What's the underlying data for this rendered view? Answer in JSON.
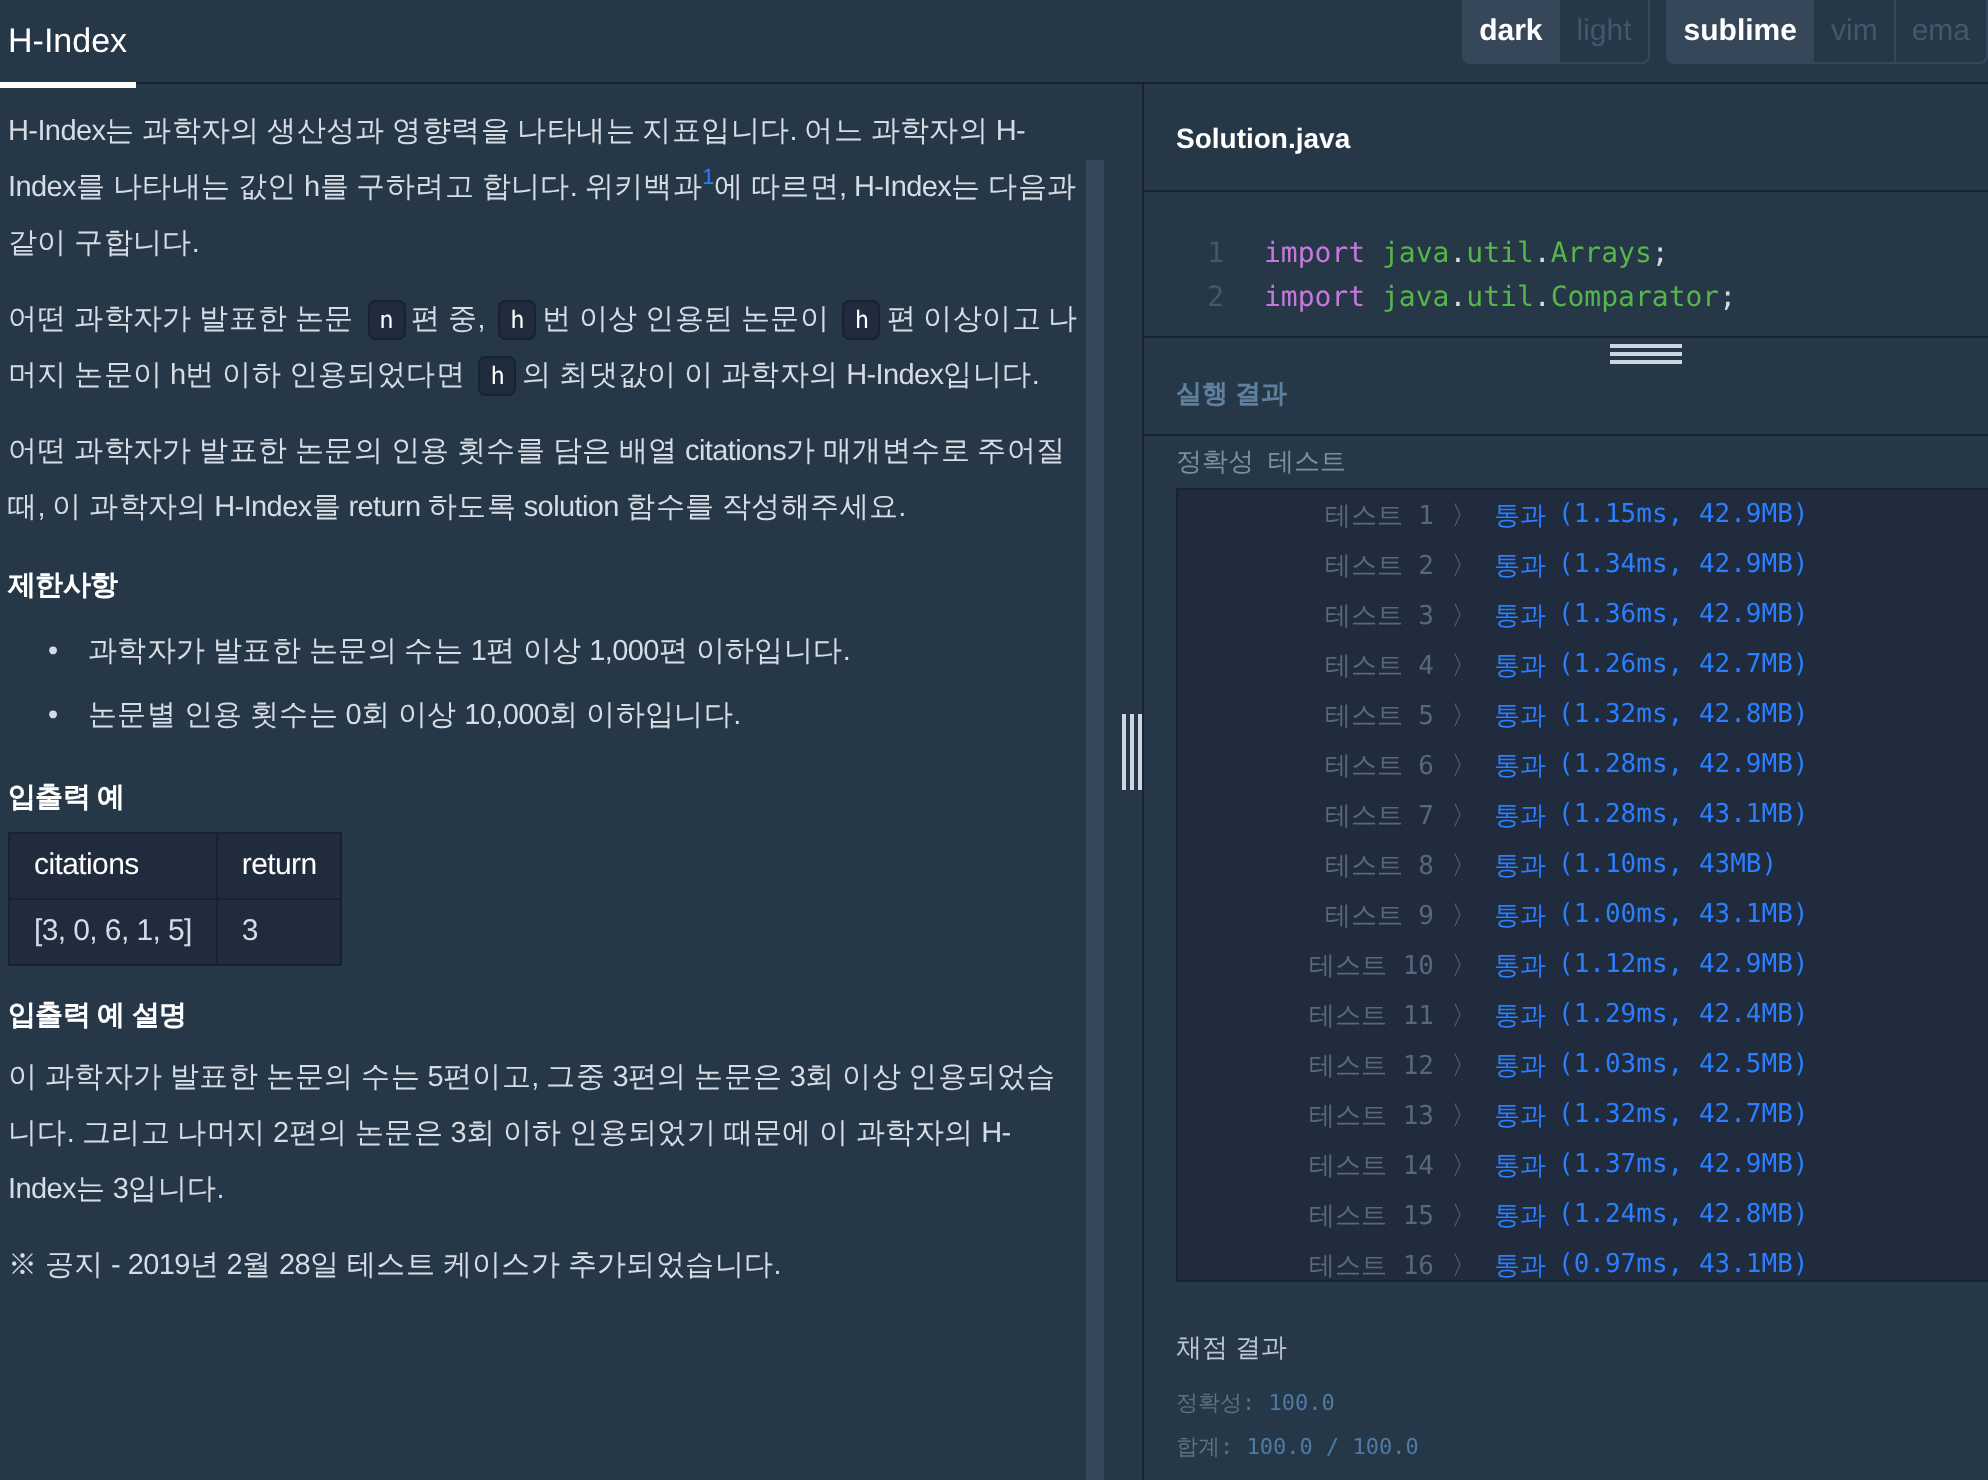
{
  "header": {
    "tab": {
      "label": "H-Index",
      "selected": true
    },
    "theme_toggle": [
      {
        "label": "dark",
        "selected": true
      },
      {
        "label": "light",
        "selected": false
      }
    ],
    "keymap_toggle": [
      {
        "label": "sublime",
        "selected": true
      },
      {
        "label": "vim",
        "selected": false
      },
      {
        "label": "ema",
        "selected": false
      }
    ]
  },
  "description": {
    "blocks": [
      {
        "kind": "paragraph",
        "text": "H-Index는 과학자의 생산성과 영향력을 나타내는 지표입니다. 어느 과학자의 H-Index를 나타내는 값인 h를 구하려고 합니다. 위키백과$^{1}$에 따르면, H-Index는 다음과 같이 구합니다."
      },
      {
        "kind": "code_paragraph",
        "segments": [
          {
            "kind": "text",
            "text": "어떤 과학자가 발표한 논문 "
          },
          {
            "kind": "code",
            "text": "n"
          },
          {
            "kind": "text",
            "text": "편 중, "
          },
          {
            "kind": "code",
            "text": "h"
          },
          {
            "kind": "text",
            "text": "번 이상 인용된 논문이 "
          },
          {
            "kind": "code",
            "text": "h"
          },
          {
            "kind": "text",
            "text": "편 이상이고 나머지 논문이 h번 이하 인용되었다면 "
          },
          {
            "kind": "code",
            "text": "h"
          },
          {
            "kind": "text",
            "text": "의 최댓값이 이 과학자의 H-Index입니다."
          }
        ]
      },
      {
        "kind": "paragraph",
        "text": "어떤 과학자가 발표한 논문의 인용 횟수를 담은 배열 citations가 매개변수로 주어질 때, 이 과학자의 H-Index를 return 하도록 solution 함수를 작성해주세요."
      },
      {
        "kind": "heading",
        "text": "제한사항"
      },
      {
        "kind": "list",
        "items": [
          {
            "marker": "•",
            "text": "과학자가 발표한 논문의 수는 1편 이상 1,000편 이하입니다."
          },
          {
            "marker": "•",
            "text": "논문별 인용 횟수는 0회 이상 10,000회 이하입니다."
          }
        ]
      },
      {
        "kind": "heading",
        "text": "입출력 예"
      },
      {
        "kind": "table",
        "columns": [
          "citations",
          "return"
        ],
        "rows": [
          [
            "[3, 0, 6, 1, 5]",
            "3"
          ]
        ]
      },
      {
        "kind": "heading",
        "text": "입출력 예 설명"
      },
      {
        "kind": "paragraph",
        "text": "이 과학자가 발표한 논문의 수는 5편이고, 그중 3편의 논문은 3회 이상 인용되었습니다. 그리고 나머지 2편의 논문은 3회 이하 인용되었기 때문에 이 과학자의 H-Index는 3입니다."
      },
      {
        "kind": "paragraph",
        "text": "※ 공지 - 2019년 2월 28일 테스트 케이스가 추가되었습니다."
      }
    ]
  },
  "editor": {
    "file_tab": "Solution.java",
    "lines": [
      {
        "number": "1",
        "tokens": [
          {
            "kind": "keyword",
            "text": "import"
          },
          {
            "kind": "name",
            "text": "java"
          },
          {
            "kind": "plain",
            "text": "."
          },
          {
            "kind": "name",
            "text": "util"
          },
          {
            "kind": "plain",
            "text": "."
          },
          {
            "kind": "name",
            "text": "Arrays"
          },
          {
            "kind": "plain",
            "text": ";"
          }
        ]
      },
      {
        "number": "2",
        "tokens": [
          {
            "kind": "keyword",
            "text": "import"
          },
          {
            "kind": "name",
            "text": "java"
          },
          {
            "kind": "plain",
            "text": "."
          },
          {
            "kind": "name",
            "text": "util"
          },
          {
            "kind": "plain",
            "text": "."
          },
          {
            "kind": "name",
            "text": "Comparator"
          },
          {
            "kind": "plain",
            "text": ";"
          }
        ]
      }
    ]
  },
  "results": {
    "title": "실행 결과",
    "section": "정확성  테스트",
    "tests": [
      {
        "label": "테스트 1",
        "arrow": "〉",
        "status": "통과",
        "detail": "(1.15ms, 42.9MB)"
      },
      {
        "label": "테스트 2",
        "arrow": "〉",
        "status": "통과",
        "detail": "(1.34ms, 42.9MB)"
      },
      {
        "label": "테스트 3",
        "arrow": "〉",
        "status": "통과",
        "detail": "(1.36ms, 42.9MB)"
      },
      {
        "label": "테스트 4",
        "arrow": "〉",
        "status": "통과",
        "detail": "(1.26ms, 42.7MB)"
      },
      {
        "label": "테스트 5",
        "arrow": "〉",
        "status": "통과",
        "detail": "(1.32ms, 42.8MB)"
      },
      {
        "label": "테스트 6",
        "arrow": "〉",
        "status": "통과",
        "detail": "(1.28ms, 42.9MB)"
      },
      {
        "label": "테스트 7",
        "arrow": "〉",
        "status": "통과",
        "detail": "(1.28ms, 43.1MB)"
      },
      {
        "label": "테스트 8",
        "arrow": "〉",
        "status": "통과",
        "detail": "(1.10ms, 43MB)"
      },
      {
        "label": "테스트 9",
        "arrow": "〉",
        "status": "통과",
        "detail": "(1.00ms, 43.1MB)"
      },
      {
        "label": "테스트 10",
        "arrow": "〉",
        "status": "통과",
        "detail": "(1.12ms, 42.9MB)"
      },
      {
        "label": "테스트 11",
        "arrow": "〉",
        "status": "통과",
        "detail": "(1.29ms, 42.4MB)"
      },
      {
        "label": "테스트 12",
        "arrow": "〉",
        "status": "통과",
        "detail": "(1.03ms, 42.5MB)"
      },
      {
        "label": "테스트 13",
        "arrow": "〉",
        "status": "통과",
        "detail": "(1.32ms, 42.7MB)"
      },
      {
        "label": "테스트 14",
        "arrow": "〉",
        "status": "통과",
        "detail": "(1.37ms, 42.9MB)"
      },
      {
        "label": "테스트 15",
        "arrow": "〉",
        "status": "통과",
        "detail": "(1.24ms, 42.8MB)"
      },
      {
        "label": "테스트 16",
        "arrow": "〉",
        "status": "통과",
        "detail": "(0.97ms, 43.1MB)"
      }
    ],
    "grading": {
      "title": "채점 결과",
      "lines": [
        {
          "label": "정확성:",
          "value": "100.0"
        },
        {
          "label": "합계:",
          "value": "100.0 / 100.0"
        }
      ]
    }
  }
}
